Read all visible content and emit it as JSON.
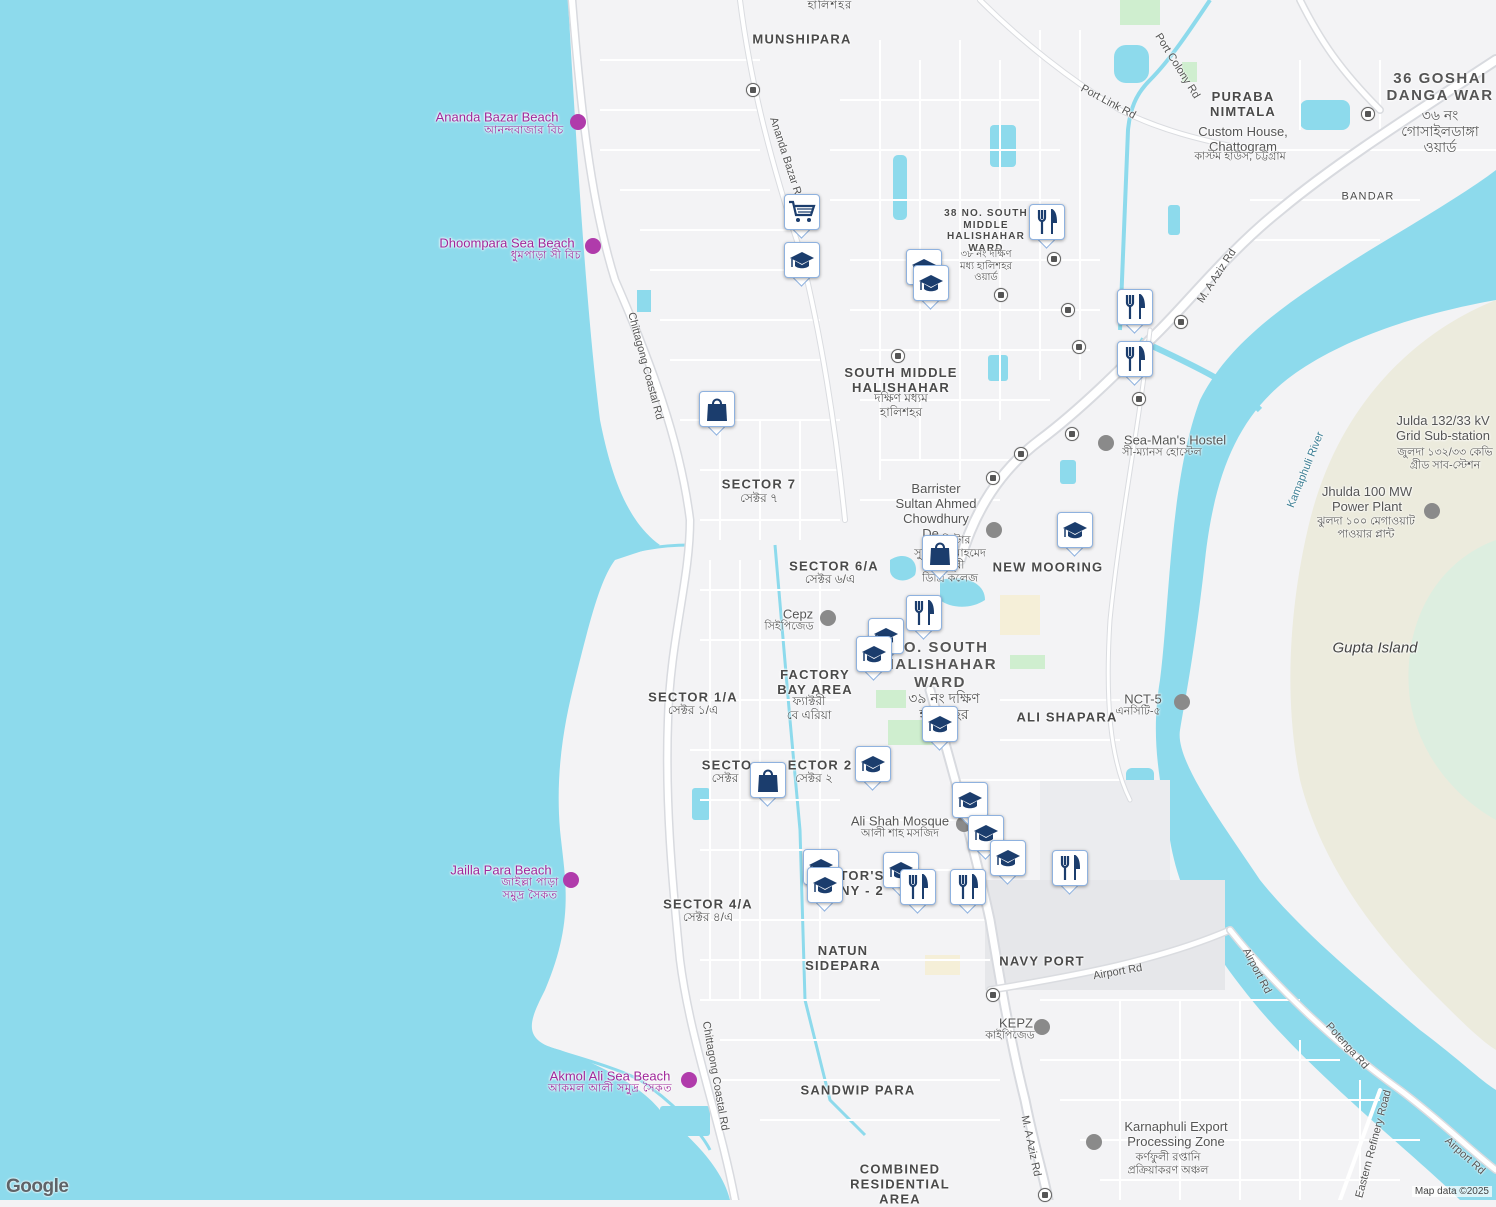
{
  "map": {
    "attribution": "Map data ©2025",
    "logo": "Google",
    "colors": {
      "water": "#8ddaec",
      "land": "#f3f3f5",
      "road": "#ffffff",
      "major_road": "#dadce0",
      "park": "#cfeecf",
      "marker_icon": "#1b3d6d"
    }
  },
  "areas": {
    "munshipara": "MUNSHIPARA",
    "puraba_nimtala": "PURABA\nNIMTALA",
    "goshai_danga": "36 GOSHAI\nDANGA WAR",
    "goshai_danga_bn": "৩৬ নং\nগোসাইলডাঙ্গা\nওয়ার্ড",
    "bandar": "BANDAR",
    "ward38": "38 NO. SOUTH\nMIDDLE\nHALISHAHAR\nWARD",
    "ward38_bn": "৩৮ নং দক্ষিণ\nমধ্য হালিশহর\nওয়ার্ড",
    "south_middle": "SOUTH MIDDLE\nHALISHAHAR",
    "south_middle_bn": "দক্ষিণ মধ্যম\nহালিশহর",
    "sector7": "SECTOR 7",
    "sector7_bn": "সেক্টর ৭",
    "sector6a": "SECTOR 6/A",
    "sector6a_bn": "সেক্টর ৬/এ",
    "new_mooring": "NEW MOORING",
    "ward39": "NO. SOUTH\nHALISHAHAR\nWARD",
    "ward39_bn": "৩৯ নং দক্ষিণ\nহালিশহর",
    "factory": "FACTORY\nBAY AREA",
    "factory_bn": "ফ্যাক্টরী\nবে এরিয়া",
    "sector1a": "SECTOR 1/A",
    "sector1a_bn": "সেক্টর ১/এ",
    "ali_shapara": "ALI SHAPARA",
    "sector_left": "SECTO",
    "sector_left_bn": "সেক্টর",
    "sector2": "ECTOR 2",
    "sector2_bn": "সেক্টর ২",
    "sector4a": "SECTOR 4/A",
    "sector4a_bn": "সেক্টর ৪/এ",
    "colony": "TOR'S\nNY - 2",
    "natun": "NATUN\nSIDEPARA",
    "navy_port": "NAVY PORT",
    "sandwip": "SANDWIP PARA",
    "combined": "COMBINED\nRESIDENTIAL\nAREA",
    "top_cut": "হালিশহর"
  },
  "places": {
    "custom_house": "Custom House,\nChattogram",
    "custom_house_bn": "কাস্টম হাউস, চট্টগ্রাম",
    "seamans": "Sea-Man's Hostel",
    "seamans_bn": "সী-ম্যানস হোস্টেল",
    "julda": "Julda 132/33 kV\nGrid Sub-station",
    "julda_bn": "জুলদা ১৩২/৩৩ কেভি\nগ্রীড সাব-স্টেশন",
    "jhulda": "Jhulda 100 MW\nPower Plant",
    "jhulda_bn": "ঝুলদা ১০০ মেগাওয়াট\nপাওয়ার প্লান্ট",
    "barrister": "Barrister\nSultan Ahmed\nChowdhury\nDe...",
    "barrister_bn": "ব্যারিস্টার\nসুলতান আহমেদ\nচৌধুরী\nডিগ্রি কলেজ",
    "cepz": "Cepz",
    "cepz_bn": "সিইপিজেড",
    "nct5": "NCT-5",
    "nct5_bn": "এনসিটি-৫",
    "ali_shah": "Ali Shah Mosque",
    "ali_shah_bn": "আলী শাহ মসজিদ",
    "kepz": "KEPZ",
    "kepz_bn": "কাইপিজেড",
    "karnaphuli": "Karnaphuli Export\nProcessing Zone",
    "karnaphuli_bn": "কর্ণফুলী রপ্তানি\nপ্রক্রিয়াকরণ অঞ্চল",
    "gupta": "Gupta Island",
    "kamaphuli_river": "Kamaphuli River"
  },
  "beaches": {
    "ananda": "Ananda Bazar Beach",
    "ananda_bn": "আনন্দবাজার বিচ",
    "dhoompara": "Dhoompara Sea Beach",
    "dhoompara_bn": "ধুমপাড়া সী বিচ",
    "jailla": "Jailla Para Beach",
    "jailla_bn": "জাইল্লা পাড়া\nসমুদ্র সৈকত",
    "akmol": "Akmol Ali Sea Beach",
    "akmol_bn": "আকমল আলী সমুদ্র সৈকত"
  },
  "roads": {
    "port_colony": "Port Colony Rd",
    "port_link": "Port Link Rd",
    "ma_aziz": "M. A Aziz Rd",
    "ananda_bazar": "Ananda Bazar R",
    "coastal": "Chittagong Coastal Rd",
    "airport": "Airport Rd",
    "potenga": "Potenga Rd",
    "eastern_refinery": "Eastern Refinery Road"
  }
}
